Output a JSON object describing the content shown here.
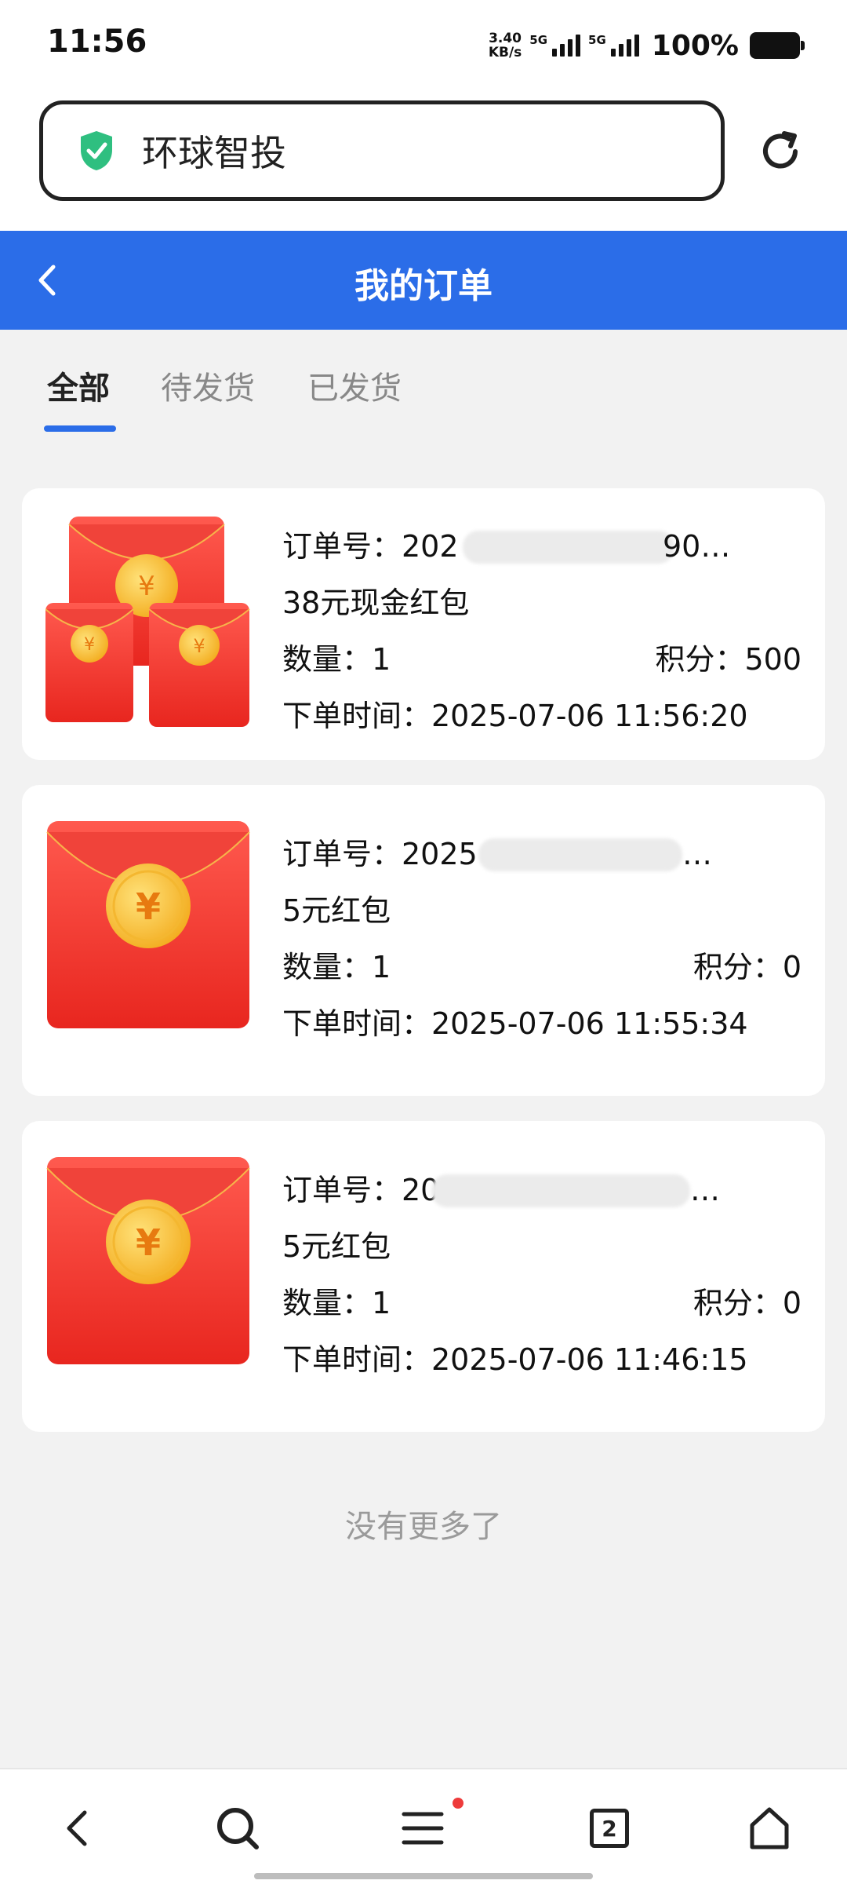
{
  "status_bar": {
    "time": "11:56",
    "net_speed_value": "3.40",
    "net_speed_unit": "KB/s",
    "signal1": "5G",
    "signal2": "5G",
    "battery": "100%"
  },
  "browser": {
    "site_title": "环球智投",
    "tab_count": "2"
  },
  "header": {
    "title": "我的订单"
  },
  "tabs": [
    {
      "label": "全部",
      "active": true
    },
    {
      "label": "待发货",
      "active": false
    },
    {
      "label": "已发货",
      "active": false
    }
  ],
  "orders": [
    {
      "order_no_prefix": "订单号：202",
      "order_no_suffix": "90…",
      "name": "38元现金红包",
      "quantity": "数量：1",
      "points": "积分：500",
      "time": "下单时间：2025-07-06 11:56:20",
      "image": "multi-red-envelope"
    },
    {
      "order_no_prefix": "订单号：2025",
      "order_no_suffix": "…",
      "name": "5元红包",
      "quantity": "数量：1",
      "points": "积分：0",
      "time": "下单时间：2025-07-06 11:55:34",
      "image": "red-envelope"
    },
    {
      "order_no_prefix": "订单号：20",
      "order_no_suffix": "…",
      "name": "5元红包",
      "quantity": "数量：1",
      "points": "积分：0",
      "time": "下单时间：2025-07-06 11:46:15",
      "image": "red-envelope"
    }
  ],
  "footer": {
    "no_more": "没有更多了"
  },
  "colors": {
    "accent": "#2b6de8",
    "envelope_red": "#f03a37",
    "coin_gold": "#f9c23c"
  }
}
